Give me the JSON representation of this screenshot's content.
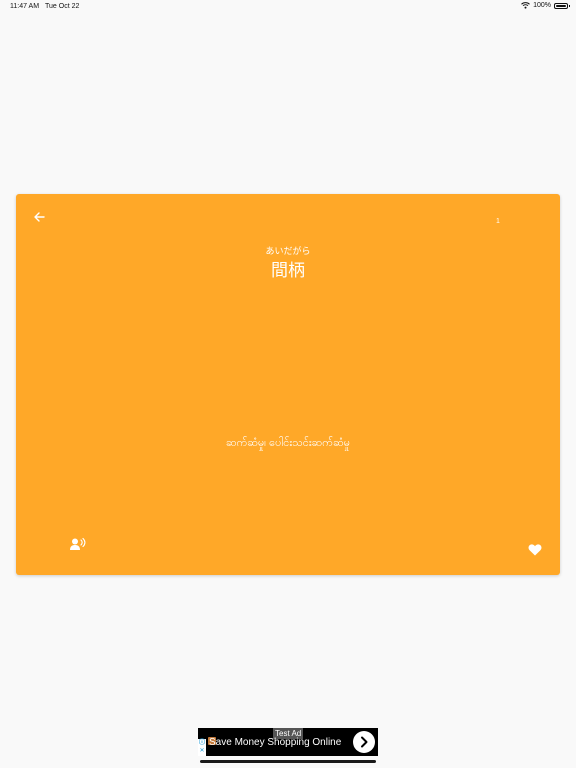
{
  "status_bar": {
    "time": "11:47 AM",
    "date": "Tue Oct 22",
    "battery": "100%",
    "icons": [
      "wifi-icon",
      "battery-icon"
    ]
  },
  "card": {
    "index": "1",
    "reading": "あいだがら",
    "term": "間柄",
    "meaning": "ဆက်ဆံမှု၊ ပေါင်းသင်းဆက်ဆံမှု",
    "color": "#ffa828",
    "icons": [
      "arrow-left-icon",
      "speaker-person-icon",
      "heart-icon"
    ]
  },
  "ad": {
    "badge": "Test Ad",
    "text": "Save Money Shopping Online",
    "choices_icons": [
      "ad-info-icon",
      "ad-close-icon"
    ],
    "cta_icon": "chevron-right-icon"
  }
}
